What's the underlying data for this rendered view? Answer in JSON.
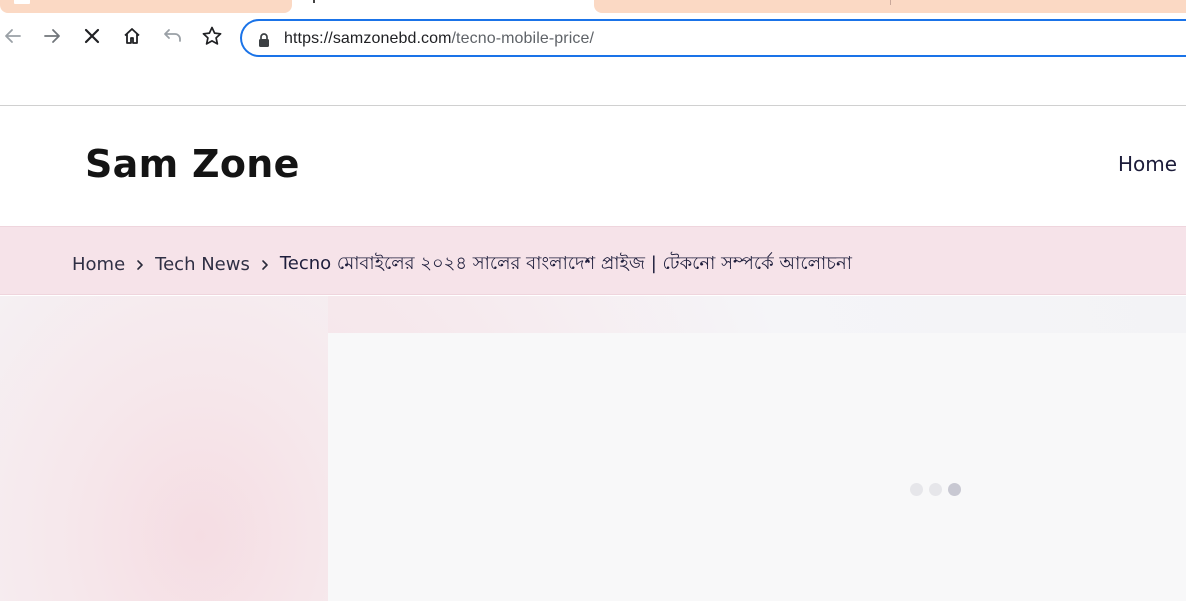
{
  "browser": {
    "url_host": "https://samzonebd.com",
    "url_path": "/tecno-mobile-price/",
    "icons": {
      "back": "arrow-left-icon",
      "forward": "arrow-right-icon",
      "stop": "close-icon",
      "home": "home-icon",
      "undo": "undo-icon",
      "bookmark": "star-icon",
      "lock": "lock-icon"
    },
    "accent_color": "#1a73e8",
    "tab_color": "#fbd9c4"
  },
  "site": {
    "logo": "Sam Zone",
    "nav": {
      "home": "Home"
    }
  },
  "breadcrumb": {
    "items": [
      {
        "label": "Home"
      },
      {
        "label": "Tech News"
      }
    ],
    "current": "Tecno মোবাইলের ২০২৪ সালের বাংলাদেশ প্রাইজ | টেকনো সম্পর্কে আলোচনা",
    "background": "#f6e3e9"
  },
  "content": {
    "loader_dots": 3,
    "loader_active_index": 2
  }
}
